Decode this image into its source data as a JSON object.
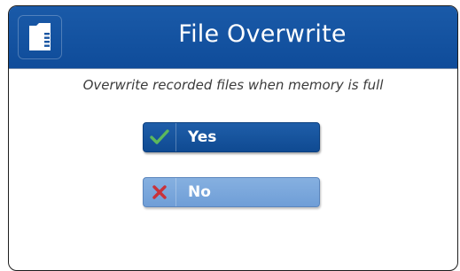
{
  "dialog": {
    "title": "File Overwrite",
    "header_icon": "memory-card-icon",
    "message": "Overwrite recorded files when memory is full"
  },
  "options": [
    {
      "label": "Yes",
      "icon": "check-icon",
      "selected": true
    },
    {
      "label": "No",
      "icon": "x-icon",
      "selected": false
    }
  ],
  "colors": {
    "header": "#1a56a2",
    "selected_option": "#164f98",
    "unselected_option": "#78a6dc",
    "check": "#5cb85c",
    "cross": "#c9323a"
  }
}
